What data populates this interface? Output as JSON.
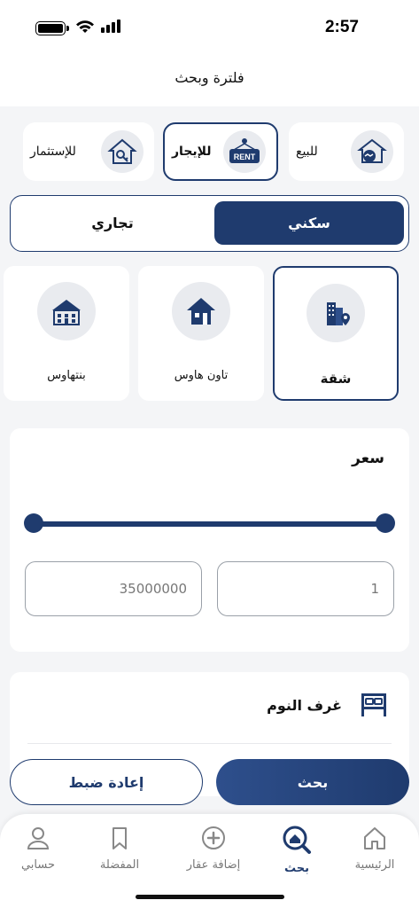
{
  "status": {
    "time": "2:57"
  },
  "header": {
    "title": "فلترة وبحث"
  },
  "listing_types": [
    {
      "label": "للبيع",
      "icon": "house-handshake-icon",
      "selected": false
    },
    {
      "label": "للإيجار",
      "icon": "rent-sign-icon",
      "selected": true,
      "sign_text": "RENT"
    },
    {
      "label": "للإستثمار",
      "icon": "house-key-icon",
      "selected": false
    }
  ],
  "categories": {
    "residential": "سكني",
    "commercial": "تجاري",
    "selected": "residential"
  },
  "property_types": [
    {
      "label": "شقة",
      "icon": "apartment-building-icon",
      "selected": true
    },
    {
      "label": "تاون هاوس",
      "icon": "townhouse-icon",
      "selected": false
    },
    {
      "label": "بنتهاوس",
      "icon": "penthouse-icon",
      "selected": false
    }
  ],
  "price": {
    "title": "سعر",
    "min_value": "1",
    "max_value": "35000000"
  },
  "bedrooms": {
    "title": "غرف النوم",
    "icon": "bed-icon"
  },
  "actions": {
    "search": "بحث",
    "reset": "إعادة ضبط"
  },
  "tabbar": {
    "home": "الرئيسية",
    "search": "بحث",
    "add_property": "إضافة عقار",
    "favorites": "المفضلة",
    "account": "حسابي",
    "active": "search"
  },
  "colors": {
    "accent": "#1f3b6e",
    "background": "#f4f5f7"
  }
}
